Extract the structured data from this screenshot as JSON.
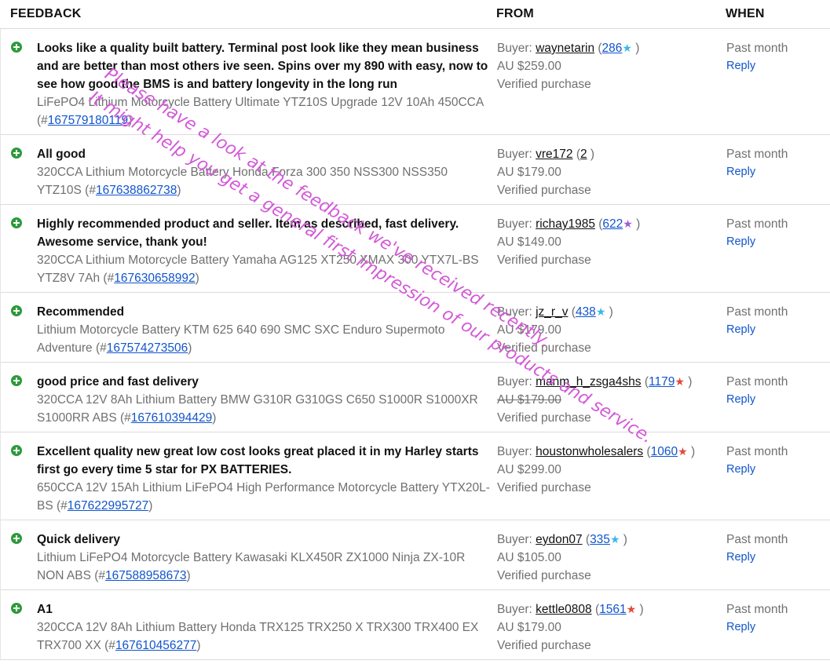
{
  "header": {
    "feedback": "FEEDBACK",
    "from": "FROM",
    "when": "WHEN"
  },
  "rows": [
    {
      "comment": "Looks like a quality built battery. Terminal post look like they mean business and are better than most others ive seen. Spins over my 890 with easy, now to see how good the BMS is and battery longevity in the long run",
      "item": "LiFePO4 Lithium Motorcycle Battery Ultimate YTZ10S Upgrade 12V 10Ah 450CCA (#",
      "item_no": "167579180119",
      "buyer_label": "Buyer: ",
      "buyer": "waynetarin",
      "score": "286",
      "star_color": "#3ab7e8",
      "price": "AU $259.00",
      "verified": "Verified purchase",
      "when": "Past month",
      "reply": "Reply"
    },
    {
      "comment": "All good",
      "item": "320CCA Lithium Motorcycle Battery Honda Forza 300 350 NSS300 NSS350 YTZ10S (#",
      "item_no": "167638862738",
      "buyer_label": "Buyer: ",
      "buyer": "vre172",
      "score": "2",
      "star_color": "",
      "price": "AU $179.00",
      "verified": "Verified purchase",
      "when": "Past month",
      "reply": "Reply"
    },
    {
      "comment": "Highly recommended product and seller. Item as described, fast delivery. Awesome service, thank you!",
      "item": "320CCA Lithium Motorcycle Battery Yamaha AG125 XT250 XMAX 300 YTX7L-BS YTZ8V 7Ah (#",
      "item_no": "167630658992",
      "buyer_label": "Buyer: ",
      "buyer": "richay1985",
      "score": "622",
      "star_color": "#a35bd6",
      "price": "AU $149.00",
      "verified": "Verified purchase",
      "when": "Past month",
      "reply": "Reply"
    },
    {
      "comment": "Recommended",
      "item": "Lithium Motorcycle Battery KTM 625 640 690 SMC SXC Enduro Supermoto Adventure (#",
      "item_no": "167574273506",
      "buyer_label": "Buyer: ",
      "buyer": "jz_r_v",
      "score": "438",
      "star_color": "#3ab7e8",
      "price": "AU $179.00",
      "verified": "Verified purchase",
      "when": "Past month",
      "reply": "Reply"
    },
    {
      "comment": "good price and fast delivery",
      "item": "320CCA 12V 8Ah Lithium Battery BMW G310R G310GS C650 S1000R S1000XR S1000RR ABS (#",
      "item_no": "167610394429",
      "buyer_label": "Buyer: ",
      "buyer": "manm_h_zsga4shs",
      "score": "1179",
      "star_color": "#e0493a",
      "price": "AU $179.00",
      "price_struck": true,
      "verified": "Verified purchase",
      "when": "Past month",
      "reply": "Reply"
    },
    {
      "comment": "Excellent quality new great low cost looks great placed it in my Harley starts first go every time 5 star for PX BATTERIES.",
      "item": "650CCA 12V 15Ah Lithium LiFePO4 High Performance Motorcycle Battery YTX20L-BS (#",
      "item_no": "167622995727",
      "buyer_label": "Buyer: ",
      "buyer": "houstonwholesalers",
      "score": "1060",
      "star_color": "#e0493a",
      "price": "AU $299.00",
      "verified": "Verified purchase",
      "when": "Past month",
      "reply": "Reply"
    },
    {
      "comment": "Quick delivery",
      "item": "Lithium LiFePO4 Motorcycle Battery Kawasaki KLX450R ZX1000 Ninja ZX-10R NON ABS (#",
      "item_no": "167588958673",
      "buyer_label": "Buyer: ",
      "buyer": "eydon07",
      "score": "335",
      "star_color": "#3ab7e8",
      "price": "AU $105.00",
      "verified": "Verified purchase",
      "when": "Past month",
      "reply": "Reply"
    },
    {
      "comment": "A1",
      "item": "320CCA 12V 8Ah Lithium Battery Honda TRX125 TRX250 X TRX300 TRX400 EX TRX700 XX (#",
      "item_no": "167610456277",
      "buyer_label": "Buyer: ",
      "buyer": "kettle0808",
      "score": "1561",
      "star_color": "#e0493a",
      "price": "AU $179.00",
      "verified": "Verified purchase",
      "when": "Past month",
      "reply": "Reply"
    }
  ],
  "overlay": {
    "line1": "Please have a look at the feedback we've received recently.",
    "line2": "It might help you get a general first impression of our products and service.",
    "color": "#d35ad8"
  }
}
